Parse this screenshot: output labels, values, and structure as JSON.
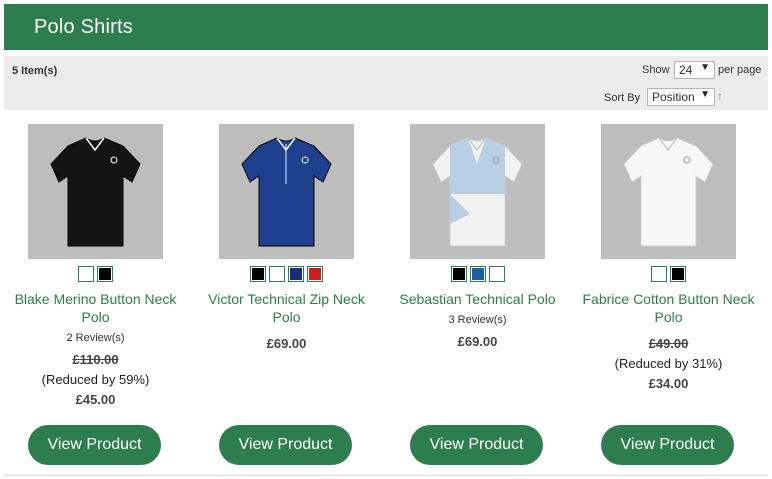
{
  "category": {
    "title": "Polo Shirts"
  },
  "toolbar": {
    "item_count": "5 Item(s)",
    "show_label": "Show",
    "per_page_value": "24",
    "per_page_label": "per page",
    "sort_label": "Sort By",
    "sort_value": "Position",
    "sort_direction_icon": "arrow-up-icon"
  },
  "colors": {
    "brand": "#2e7d4f",
    "toolbar_bg": "#ececec",
    "sort_arrow": "#e07b00"
  },
  "products": [
    {
      "name": "Blake Merino Button Neck Polo",
      "swatches": [
        "#ffffff",
        "#000000"
      ],
      "reviews": "2 Review(s)",
      "old_price": "£110.00",
      "reduced": "(Reduced by 59%)",
      "price": "£45.00",
      "button": "View Product",
      "shirt_color": "#141414"
    },
    {
      "name": "Victor Technical Zip Neck Polo",
      "swatches": [
        "#000000",
        "#ffffff",
        "#1c2a78",
        "#c81e1e"
      ],
      "reviews": "",
      "old_price": "",
      "reduced": "",
      "price": "£69.00",
      "button": "View Product",
      "shirt_color": "#1f3f8f"
    },
    {
      "name": "Sebastian Technical Polo",
      "swatches": [
        "#000000",
        "#1f5fa0",
        "#ffffff"
      ],
      "reviews": "3 Review(s)",
      "old_price": "",
      "reduced": "",
      "price": "£69.00",
      "button": "View Product",
      "shirt_color": "#f2f2f2"
    },
    {
      "name": "Fabrice Cotton Button Neck Polo",
      "swatches": [
        "#ffffff",
        "#000000"
      ],
      "reviews": "",
      "old_price": "£49.00",
      "reduced": "(Reduced by 31%)",
      "price": "£34.00",
      "button": "View Product",
      "shirt_color": "#f7f7f7"
    }
  ]
}
